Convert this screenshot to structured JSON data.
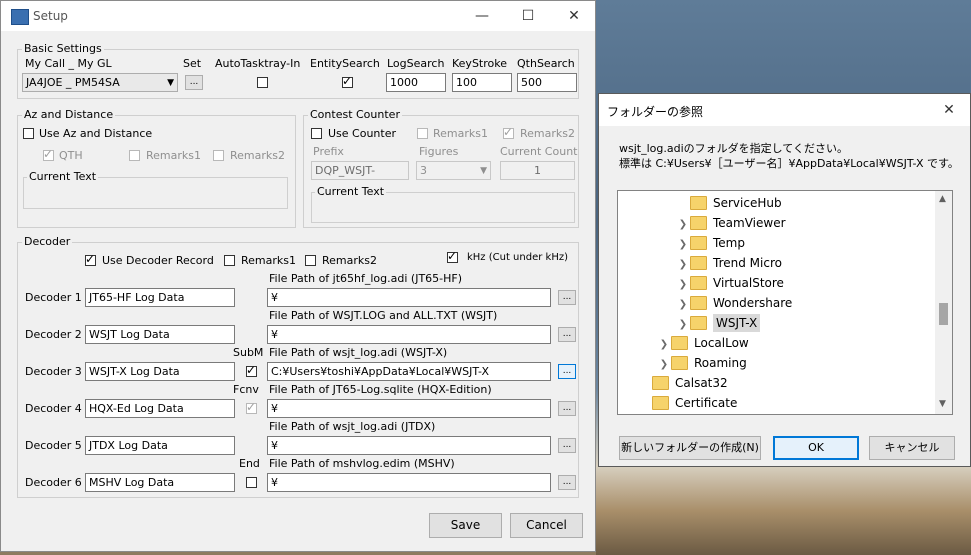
{
  "setup": {
    "title": "Setup",
    "basic": {
      "group_label": "Basic Settings",
      "mycall_label": "My Call _ My GL",
      "mycall_value": "JA4JOE _ PM54SA",
      "set_label": "Set",
      "set_button": "...",
      "autotasktray_label": "AutoTasktray-In",
      "entitysearch_label": "EntitySearch",
      "logsearch_label": "LogSearch",
      "logsearch_value": "1000",
      "keystroke_label": "KeyStroke",
      "keystroke_value": "100",
      "qthsearch_label": "QthSearch",
      "qthsearch_value": "500"
    },
    "az": {
      "group_label": "Az and Distance",
      "use_label": "Use Az and Distance",
      "qth_label": "QTH",
      "remarks1_label": "Remarks1",
      "remarks2_label": "Remarks2",
      "current_text_label": "Current Text"
    },
    "contest": {
      "group_label": "Contest Counter",
      "use_label": "Use Counter",
      "remarks1_label": "Remarks1",
      "remarks2_label": "Remarks2",
      "prefix_label": "Prefix",
      "prefix_value": "DQP_WSJT-",
      "figures_label": "Figures",
      "figures_value": "3",
      "count_label": "Current Count",
      "count_value": "1",
      "current_text_label": "Current Text"
    },
    "decoder": {
      "group_label": "Decoder",
      "use_record_label": "Use Decoder Record",
      "remarks1_label": "Remarks1",
      "remarks2_label": "Remarks2",
      "khz_label": "kHz (Cut under kHz)",
      "rows": [
        {
          "label": "Decoder 1",
          "name": "JT65-HF Log Data",
          "path_label": "File Path of jt65hf_log.adi (JT65-HF)",
          "path": "¥",
          "side_label": ""
        },
        {
          "label": "Decoder 2",
          "name": "WSJT Log Data",
          "path_label": "File Path of WSJT.LOG and ALL.TXT (WSJT)",
          "path": "¥",
          "side_label": ""
        },
        {
          "label": "Decoder 3",
          "name": "WSJT-X Log Data",
          "path_label": "File Path of wsjt_log.adi (WSJT-X)",
          "path": "C:¥Users¥toshi¥AppData¥Local¥WSJT-X",
          "side_label": "SubM"
        },
        {
          "label": "Decoder 4",
          "name": "HQX-Ed Log Data",
          "path_label": "File Path of JT65-Log.sqlite (HQX-Edition)",
          "path": "¥",
          "side_label": "Fcnv"
        },
        {
          "label": "Decoder 5",
          "name": "JTDX Log Data",
          "path_label": "File Path of wsjt_log.adi (JTDX)",
          "path": "¥",
          "side_label": ""
        },
        {
          "label": "Decoder 6",
          "name": "MSHV Log Data",
          "path_label": "File Path of mshvlog.edim (MSHV)",
          "path": "¥",
          "side_label": "End"
        }
      ],
      "browse_button": "..."
    },
    "save_button": "Save",
    "cancel_button": "Cancel"
  },
  "folder_dialog": {
    "title": "フォルダーの参照",
    "instruction_line1": "wsjt_log.adiのフォルダを指定してください。",
    "instruction_line2": "標準は C:¥Users¥［ユーザー名］¥AppData¥Local¥WSJT-X です。",
    "tree": [
      {
        "label": "ServiceHub",
        "expandable": false
      },
      {
        "label": "TeamViewer",
        "expandable": true
      },
      {
        "label": "Temp",
        "expandable": true
      },
      {
        "label": "Trend Micro",
        "expandable": true
      },
      {
        "label": "VirtualStore",
        "expandable": true
      },
      {
        "label": "Wondershare",
        "expandable": true
      },
      {
        "label": "WSJT-X",
        "expandable": true,
        "selected": true
      },
      {
        "label": "LocalLow",
        "expandable": true
      },
      {
        "label": "Roaming",
        "expandable": true
      },
      {
        "label": "Calsat32",
        "expandable": false
      },
      {
        "label": "Certificate",
        "expandable": false
      }
    ],
    "new_folder_button": "新しいフォルダーの作成(N)",
    "ok_button": "OK",
    "cancel_button": "キャンセル"
  }
}
